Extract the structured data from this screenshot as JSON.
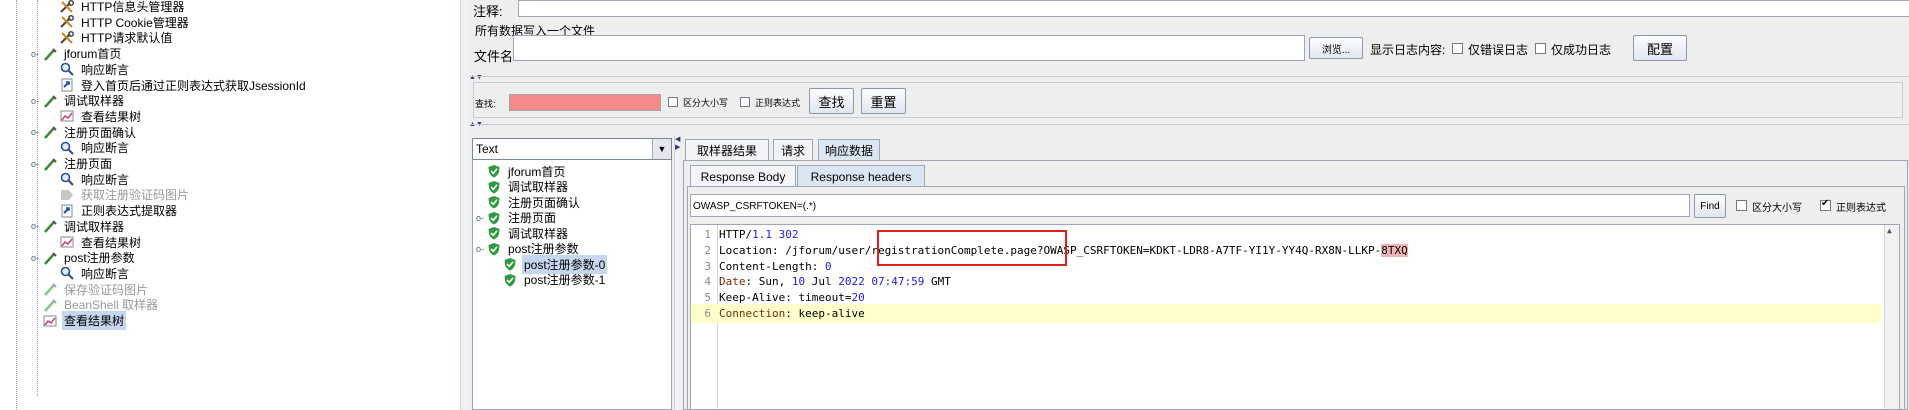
{
  "tree": [
    {
      "label": "HTTP信息头管理器",
      "icon": "wrench-icon",
      "indent": 2,
      "key": "",
      "state": ""
    },
    {
      "label": "HTTP Cookie管理器",
      "icon": "wrench-icon",
      "indent": 2,
      "key": "",
      "state": ""
    },
    {
      "label": "HTTP请求默认值",
      "icon": "wrench-icon",
      "indent": 2,
      "key": "",
      "state": ""
    },
    {
      "label": "jforum首页",
      "icon": "pipette-icon",
      "indent": 1,
      "key": "o-",
      "state": ""
    },
    {
      "label": "响应断言",
      "icon": "magnifier-icon",
      "indent": 2,
      "key": "",
      "state": ""
    },
    {
      "label": "登入首页后通过正则表达式获取JsessionId",
      "icon": "arrow-doc-icon",
      "indent": 2,
      "key": "",
      "state": ""
    },
    {
      "label": "调试取样器",
      "icon": "pipette-icon",
      "indent": 1,
      "key": "o-",
      "state": ""
    },
    {
      "label": "查看结果树",
      "icon": "chart-icon",
      "indent": 2,
      "key": "",
      "state": ""
    },
    {
      "label": "注册页面确认",
      "icon": "pipette-icon",
      "indent": 1,
      "key": "o-",
      "state": ""
    },
    {
      "label": "响应断言",
      "icon": "magnifier-icon",
      "indent": 2,
      "key": "",
      "state": ""
    },
    {
      "label": "注册页面",
      "icon": "pipette-icon",
      "indent": 1,
      "key": "o-",
      "state": ""
    },
    {
      "label": "响应断言",
      "icon": "magnifier-icon",
      "indent": 2,
      "key": "",
      "state": ""
    },
    {
      "label": "获取注册验证码图片",
      "icon": "tag-icon",
      "indent": 2,
      "key": "",
      "state": "dis"
    },
    {
      "label": "正则表达式提取器",
      "icon": "arrow-doc-icon",
      "indent": 2,
      "key": "",
      "state": ""
    },
    {
      "label": "调试取样器",
      "icon": "pipette-icon",
      "indent": 1,
      "key": "o-",
      "state": ""
    },
    {
      "label": "查看结果树",
      "icon": "chart-icon",
      "indent": 2,
      "key": "",
      "state": ""
    },
    {
      "label": "post注册参数",
      "icon": "pipette-icon",
      "indent": 1,
      "key": "o-",
      "state": ""
    },
    {
      "label": "响应断言",
      "icon": "magnifier-icon",
      "indent": 2,
      "key": "",
      "state": ""
    },
    {
      "label": "保存验证码图片",
      "icon": "pipette-icon",
      "indent": 1,
      "key": "",
      "state": "dis"
    },
    {
      "label": "BeanShell 取样器",
      "icon": "pipette-icon",
      "indent": 1,
      "key": "",
      "state": "dis"
    },
    {
      "label": "查看结果树",
      "icon": "chart-icon",
      "indent": 1,
      "key": "",
      "state": "sel"
    }
  ],
  "comment_label": "注释:",
  "file_group_title": "所有数据写入一个文件",
  "filename_label": "文件名",
  "filename_value": "",
  "browse_button": "浏览...",
  "log_display_label": "显示日志内容:",
  "errors_only_label": "仅错误日志",
  "success_only_label": "仅成功日志",
  "configure_button": "配置",
  "search_label": "查找:",
  "case_sensitive_label": "区分大小写",
  "regex_label": "正则表达式",
  "find_button": "查找",
  "reset_button": "重置",
  "renderer_select": "Text",
  "results": [
    {
      "label": "jforum首页",
      "indent": 0,
      "key": "",
      "sel": false
    },
    {
      "label": "调试取样器",
      "indent": 0,
      "key": "",
      "sel": false
    },
    {
      "label": "注册页面确认",
      "indent": 0,
      "key": "",
      "sel": false
    },
    {
      "label": "注册页面",
      "indent": 0,
      "key": "o-",
      "sel": false
    },
    {
      "label": "调试取样器",
      "indent": 0,
      "key": "",
      "sel": false
    },
    {
      "label": "post注册参数",
      "indent": 0,
      "key": "o-",
      "sel": false
    },
    {
      "label": "post注册参数-0",
      "indent": 1,
      "key": "",
      "sel": true
    },
    {
      "label": "post注册参数-1",
      "indent": 1,
      "key": "",
      "sel": false
    }
  ],
  "tabs": [
    "取样器结果",
    "请求",
    "响应数据"
  ],
  "active_tab": 2,
  "subtabs": [
    "Response Body",
    "Response headers"
  ],
  "active_subtab": 1,
  "header_search_value": "OWASP_CSRFTOKEN=(.*)",
  "header_find_button": "Find",
  "header_case_label": "区分大小写",
  "header_regex_label": "正则表达式",
  "header_regex_checked": true,
  "code": [
    {
      "n": "1",
      "text": "HTTP/1.1 302"
    },
    {
      "n": "2",
      "text": "Location: /jforum/user/registrationComplete.page?OWASP_CSRFTOKEN=KDKT-LDR8-A7TF-YI1Y-YY4Q-RX8N-LLKP-8TXQ"
    },
    {
      "n": "3",
      "text": "Content-Length: 0"
    },
    {
      "n": "4",
      "text": "Date: Sun, 10 Jul 2022 07:47:59 GMT"
    },
    {
      "n": "5",
      "text": "Keep-Alive: timeout=20"
    },
    {
      "n": "6",
      "text": "Connection: keep-alive"
    }
  ],
  "highlight_line": 6,
  "colors": {
    "search_bg": "#f58a8a",
    "selection": "#c5d7ee",
    "current_line": "#ffffcc",
    "annotation_box": "#e0201a"
  }
}
